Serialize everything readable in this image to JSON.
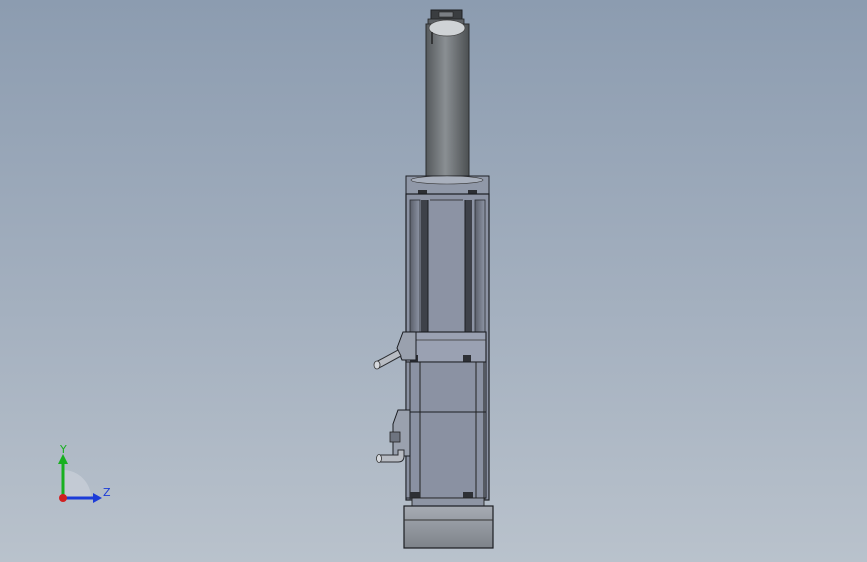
{
  "view": {
    "background_top": "#8c9cb0",
    "background_bottom": "#b9c2cc"
  },
  "model": {
    "description_icon": "linear-actuator-model"
  },
  "triad": {
    "y_label": "Y",
    "z_label": "Z",
    "colors": {
      "y": "#18b020",
      "z": "#1c3cd8",
      "x": "#d02020"
    }
  }
}
